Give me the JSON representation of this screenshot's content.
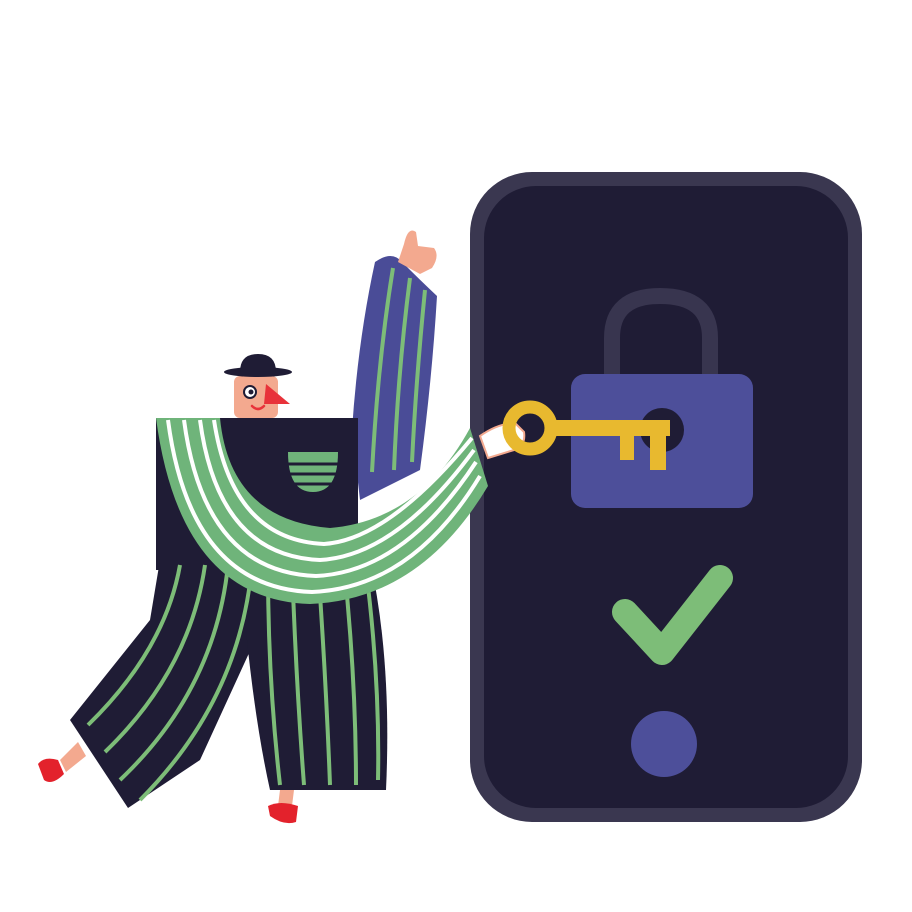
{
  "illustration": {
    "subject": "unlock-phone-with-key",
    "colors": {
      "background": "#ffffff",
      "phone_frame": "#3a3750",
      "phone_screen": "#1f1c35",
      "lock_body": "#4d4f9a",
      "lock_shackle": "#38354f",
      "key": "#e8b92f",
      "check": "#7dbd78",
      "home_button": "#4d4f9a",
      "garment_green": "#6fb47a",
      "garment_navy": "#1f1c35",
      "sleeve_blue": "#4a4c97",
      "stripe_white": "#ffffff",
      "skin": "#f3a98f",
      "nose": "#e8323a",
      "shoes": "#e3222c"
    },
    "icons": [
      "padlock-icon",
      "key-icon",
      "checkmark-icon",
      "home-button-icon"
    ]
  }
}
